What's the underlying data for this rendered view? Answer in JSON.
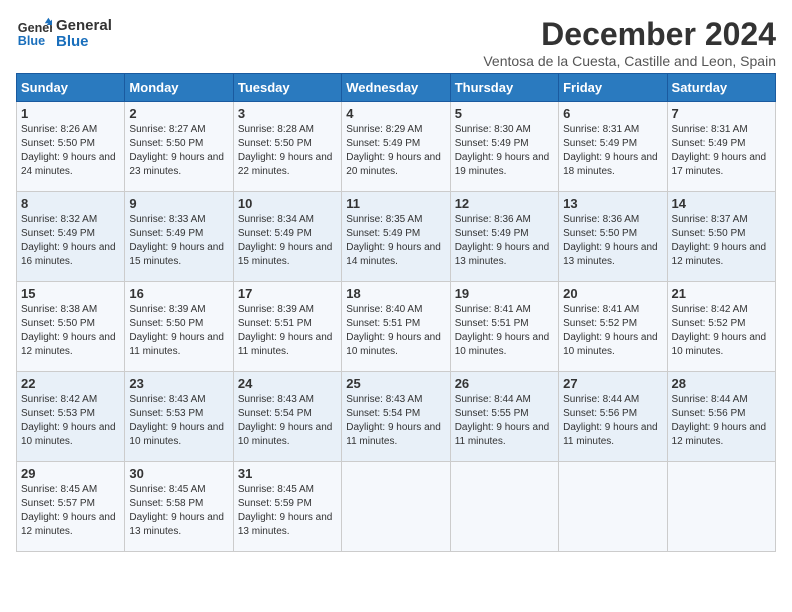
{
  "logo": {
    "line1": "General",
    "line2": "Blue"
  },
  "header": {
    "month": "December 2024",
    "location": "Ventosa de la Cuesta, Castille and Leon, Spain"
  },
  "columns": [
    "Sunday",
    "Monday",
    "Tuesday",
    "Wednesday",
    "Thursday",
    "Friday",
    "Saturday"
  ],
  "weeks": [
    [
      {
        "day": "1",
        "sunrise": "Sunrise: 8:26 AM",
        "sunset": "Sunset: 5:50 PM",
        "daylight": "Daylight: 9 hours and 24 minutes."
      },
      {
        "day": "2",
        "sunrise": "Sunrise: 8:27 AM",
        "sunset": "Sunset: 5:50 PM",
        "daylight": "Daylight: 9 hours and 23 minutes."
      },
      {
        "day": "3",
        "sunrise": "Sunrise: 8:28 AM",
        "sunset": "Sunset: 5:50 PM",
        "daylight": "Daylight: 9 hours and 22 minutes."
      },
      {
        "day": "4",
        "sunrise": "Sunrise: 8:29 AM",
        "sunset": "Sunset: 5:49 PM",
        "daylight": "Daylight: 9 hours and 20 minutes."
      },
      {
        "day": "5",
        "sunrise": "Sunrise: 8:30 AM",
        "sunset": "Sunset: 5:49 PM",
        "daylight": "Daylight: 9 hours and 19 minutes."
      },
      {
        "day": "6",
        "sunrise": "Sunrise: 8:31 AM",
        "sunset": "Sunset: 5:49 PM",
        "daylight": "Daylight: 9 hours and 18 minutes."
      },
      {
        "day": "7",
        "sunrise": "Sunrise: 8:31 AM",
        "sunset": "Sunset: 5:49 PM",
        "daylight": "Daylight: 9 hours and 17 minutes."
      }
    ],
    [
      {
        "day": "8",
        "sunrise": "Sunrise: 8:32 AM",
        "sunset": "Sunset: 5:49 PM",
        "daylight": "Daylight: 9 hours and 16 minutes."
      },
      {
        "day": "9",
        "sunrise": "Sunrise: 8:33 AM",
        "sunset": "Sunset: 5:49 PM",
        "daylight": "Daylight: 9 hours and 15 minutes."
      },
      {
        "day": "10",
        "sunrise": "Sunrise: 8:34 AM",
        "sunset": "Sunset: 5:49 PM",
        "daylight": "Daylight: 9 hours and 15 minutes."
      },
      {
        "day": "11",
        "sunrise": "Sunrise: 8:35 AM",
        "sunset": "Sunset: 5:49 PM",
        "daylight": "Daylight: 9 hours and 14 minutes."
      },
      {
        "day": "12",
        "sunrise": "Sunrise: 8:36 AM",
        "sunset": "Sunset: 5:49 PM",
        "daylight": "Daylight: 9 hours and 13 minutes."
      },
      {
        "day": "13",
        "sunrise": "Sunrise: 8:36 AM",
        "sunset": "Sunset: 5:50 PM",
        "daylight": "Daylight: 9 hours and 13 minutes."
      },
      {
        "day": "14",
        "sunrise": "Sunrise: 8:37 AM",
        "sunset": "Sunset: 5:50 PM",
        "daylight": "Daylight: 9 hours and 12 minutes."
      }
    ],
    [
      {
        "day": "15",
        "sunrise": "Sunrise: 8:38 AM",
        "sunset": "Sunset: 5:50 PM",
        "daylight": "Daylight: 9 hours and 12 minutes."
      },
      {
        "day": "16",
        "sunrise": "Sunrise: 8:39 AM",
        "sunset": "Sunset: 5:50 PM",
        "daylight": "Daylight: 9 hours and 11 minutes."
      },
      {
        "day": "17",
        "sunrise": "Sunrise: 8:39 AM",
        "sunset": "Sunset: 5:51 PM",
        "daylight": "Daylight: 9 hours and 11 minutes."
      },
      {
        "day": "18",
        "sunrise": "Sunrise: 8:40 AM",
        "sunset": "Sunset: 5:51 PM",
        "daylight": "Daylight: 9 hours and 10 minutes."
      },
      {
        "day": "19",
        "sunrise": "Sunrise: 8:41 AM",
        "sunset": "Sunset: 5:51 PM",
        "daylight": "Daylight: 9 hours and 10 minutes."
      },
      {
        "day": "20",
        "sunrise": "Sunrise: 8:41 AM",
        "sunset": "Sunset: 5:52 PM",
        "daylight": "Daylight: 9 hours and 10 minutes."
      },
      {
        "day": "21",
        "sunrise": "Sunrise: 8:42 AM",
        "sunset": "Sunset: 5:52 PM",
        "daylight": "Daylight: 9 hours and 10 minutes."
      }
    ],
    [
      {
        "day": "22",
        "sunrise": "Sunrise: 8:42 AM",
        "sunset": "Sunset: 5:53 PM",
        "daylight": "Daylight: 9 hours and 10 minutes."
      },
      {
        "day": "23",
        "sunrise": "Sunrise: 8:43 AM",
        "sunset": "Sunset: 5:53 PM",
        "daylight": "Daylight: 9 hours and 10 minutes."
      },
      {
        "day": "24",
        "sunrise": "Sunrise: 8:43 AM",
        "sunset": "Sunset: 5:54 PM",
        "daylight": "Daylight: 9 hours and 10 minutes."
      },
      {
        "day": "25",
        "sunrise": "Sunrise: 8:43 AM",
        "sunset": "Sunset: 5:54 PM",
        "daylight": "Daylight: 9 hours and 11 minutes."
      },
      {
        "day": "26",
        "sunrise": "Sunrise: 8:44 AM",
        "sunset": "Sunset: 5:55 PM",
        "daylight": "Daylight: 9 hours and 11 minutes."
      },
      {
        "day": "27",
        "sunrise": "Sunrise: 8:44 AM",
        "sunset": "Sunset: 5:56 PM",
        "daylight": "Daylight: 9 hours and 11 minutes."
      },
      {
        "day": "28",
        "sunrise": "Sunrise: 8:44 AM",
        "sunset": "Sunset: 5:56 PM",
        "daylight": "Daylight: 9 hours and 12 minutes."
      }
    ],
    [
      {
        "day": "29",
        "sunrise": "Sunrise: 8:45 AM",
        "sunset": "Sunset: 5:57 PM",
        "daylight": "Daylight: 9 hours and 12 minutes."
      },
      {
        "day": "30",
        "sunrise": "Sunrise: 8:45 AM",
        "sunset": "Sunset: 5:58 PM",
        "daylight": "Daylight: 9 hours and 13 minutes."
      },
      {
        "day": "31",
        "sunrise": "Sunrise: 8:45 AM",
        "sunset": "Sunset: 5:59 PM",
        "daylight": "Daylight: 9 hours and 13 minutes."
      },
      null,
      null,
      null,
      null
    ]
  ]
}
